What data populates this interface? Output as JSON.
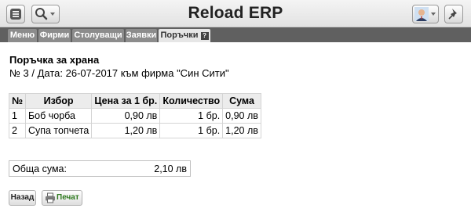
{
  "app": {
    "title": "Reload ERP"
  },
  "tabs": [
    {
      "label": "Меню"
    },
    {
      "label": "Фирми"
    },
    {
      "label": "Столуващи"
    },
    {
      "label": "Заявки"
    },
    {
      "label": "Поръчки",
      "active": true,
      "help": "?"
    }
  ],
  "order": {
    "heading": "Поръчка за храна",
    "subheading": "№ 3 / Дата: 26-07-2017 към фирма \"Син Сити\""
  },
  "table": {
    "headers": [
      "№",
      "Избор",
      "Цена за 1 бр.",
      "Количество",
      "Сума"
    ],
    "rows": [
      {
        "no": "1",
        "item": "Боб чорба",
        "price": "0,90 лв",
        "qty": "1 бр.",
        "sum": "0,90 лв"
      },
      {
        "no": "2",
        "item": "Супа топчета",
        "price": "1,20 лв",
        "qty": "1 бр.",
        "sum": "1,20 лв"
      }
    ]
  },
  "total": {
    "label": "Обща сума:",
    "value": "2,10 лв"
  },
  "buttons": {
    "back": "Назад",
    "print": "Печат"
  },
  "colors": {
    "tab_bar": "#606060",
    "tab": "#8c8c8c",
    "print_text": "#2e7a1f"
  },
  "icons": [
    "menu-icon",
    "search-icon",
    "chevron-down-icon",
    "user-avatar-icon",
    "pin-icon",
    "help-icon",
    "printer-icon"
  ]
}
